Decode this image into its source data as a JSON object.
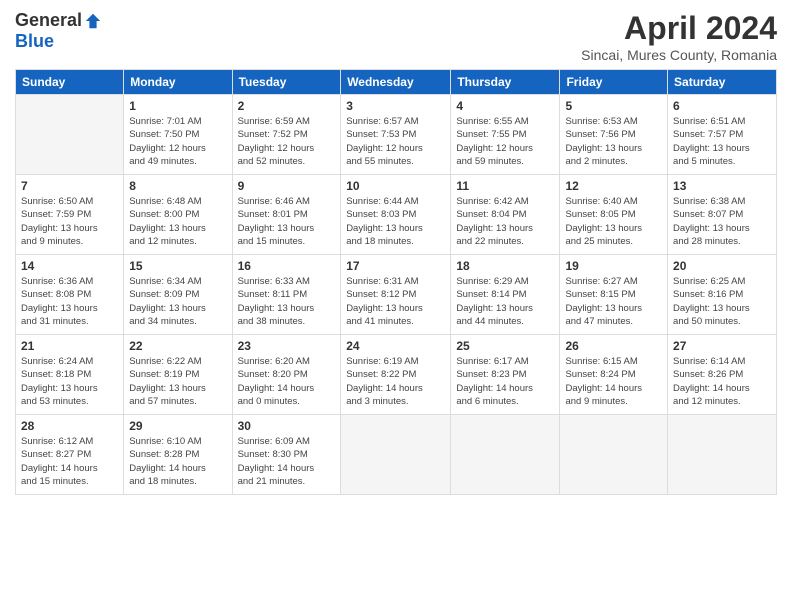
{
  "logo": {
    "general": "General",
    "blue": "Blue"
  },
  "title": "April 2024",
  "subtitle": "Sincai, Mures County, Romania",
  "days_of_week": [
    "Sunday",
    "Monday",
    "Tuesday",
    "Wednesday",
    "Thursday",
    "Friday",
    "Saturday"
  ],
  "weeks": [
    [
      {
        "num": "",
        "info": ""
      },
      {
        "num": "1",
        "info": "Sunrise: 7:01 AM\nSunset: 7:50 PM\nDaylight: 12 hours\nand 49 minutes."
      },
      {
        "num": "2",
        "info": "Sunrise: 6:59 AM\nSunset: 7:52 PM\nDaylight: 12 hours\nand 52 minutes."
      },
      {
        "num": "3",
        "info": "Sunrise: 6:57 AM\nSunset: 7:53 PM\nDaylight: 12 hours\nand 55 minutes."
      },
      {
        "num": "4",
        "info": "Sunrise: 6:55 AM\nSunset: 7:55 PM\nDaylight: 12 hours\nand 59 minutes."
      },
      {
        "num": "5",
        "info": "Sunrise: 6:53 AM\nSunset: 7:56 PM\nDaylight: 13 hours\nand 2 minutes."
      },
      {
        "num": "6",
        "info": "Sunrise: 6:51 AM\nSunset: 7:57 PM\nDaylight: 13 hours\nand 5 minutes."
      }
    ],
    [
      {
        "num": "7",
        "info": "Sunrise: 6:50 AM\nSunset: 7:59 PM\nDaylight: 13 hours\nand 9 minutes."
      },
      {
        "num": "8",
        "info": "Sunrise: 6:48 AM\nSunset: 8:00 PM\nDaylight: 13 hours\nand 12 minutes."
      },
      {
        "num": "9",
        "info": "Sunrise: 6:46 AM\nSunset: 8:01 PM\nDaylight: 13 hours\nand 15 minutes."
      },
      {
        "num": "10",
        "info": "Sunrise: 6:44 AM\nSunset: 8:03 PM\nDaylight: 13 hours\nand 18 minutes."
      },
      {
        "num": "11",
        "info": "Sunrise: 6:42 AM\nSunset: 8:04 PM\nDaylight: 13 hours\nand 22 minutes."
      },
      {
        "num": "12",
        "info": "Sunrise: 6:40 AM\nSunset: 8:05 PM\nDaylight: 13 hours\nand 25 minutes."
      },
      {
        "num": "13",
        "info": "Sunrise: 6:38 AM\nSunset: 8:07 PM\nDaylight: 13 hours\nand 28 minutes."
      }
    ],
    [
      {
        "num": "14",
        "info": "Sunrise: 6:36 AM\nSunset: 8:08 PM\nDaylight: 13 hours\nand 31 minutes."
      },
      {
        "num": "15",
        "info": "Sunrise: 6:34 AM\nSunset: 8:09 PM\nDaylight: 13 hours\nand 34 minutes."
      },
      {
        "num": "16",
        "info": "Sunrise: 6:33 AM\nSunset: 8:11 PM\nDaylight: 13 hours\nand 38 minutes."
      },
      {
        "num": "17",
        "info": "Sunrise: 6:31 AM\nSunset: 8:12 PM\nDaylight: 13 hours\nand 41 minutes."
      },
      {
        "num": "18",
        "info": "Sunrise: 6:29 AM\nSunset: 8:14 PM\nDaylight: 13 hours\nand 44 minutes."
      },
      {
        "num": "19",
        "info": "Sunrise: 6:27 AM\nSunset: 8:15 PM\nDaylight: 13 hours\nand 47 minutes."
      },
      {
        "num": "20",
        "info": "Sunrise: 6:25 AM\nSunset: 8:16 PM\nDaylight: 13 hours\nand 50 minutes."
      }
    ],
    [
      {
        "num": "21",
        "info": "Sunrise: 6:24 AM\nSunset: 8:18 PM\nDaylight: 13 hours\nand 53 minutes."
      },
      {
        "num": "22",
        "info": "Sunrise: 6:22 AM\nSunset: 8:19 PM\nDaylight: 13 hours\nand 57 minutes."
      },
      {
        "num": "23",
        "info": "Sunrise: 6:20 AM\nSunset: 8:20 PM\nDaylight: 14 hours\nand 0 minutes."
      },
      {
        "num": "24",
        "info": "Sunrise: 6:19 AM\nSunset: 8:22 PM\nDaylight: 14 hours\nand 3 minutes."
      },
      {
        "num": "25",
        "info": "Sunrise: 6:17 AM\nSunset: 8:23 PM\nDaylight: 14 hours\nand 6 minutes."
      },
      {
        "num": "26",
        "info": "Sunrise: 6:15 AM\nSunset: 8:24 PM\nDaylight: 14 hours\nand 9 minutes."
      },
      {
        "num": "27",
        "info": "Sunrise: 6:14 AM\nSunset: 8:26 PM\nDaylight: 14 hours\nand 12 minutes."
      }
    ],
    [
      {
        "num": "28",
        "info": "Sunrise: 6:12 AM\nSunset: 8:27 PM\nDaylight: 14 hours\nand 15 minutes."
      },
      {
        "num": "29",
        "info": "Sunrise: 6:10 AM\nSunset: 8:28 PM\nDaylight: 14 hours\nand 18 minutes."
      },
      {
        "num": "30",
        "info": "Sunrise: 6:09 AM\nSunset: 8:30 PM\nDaylight: 14 hours\nand 21 minutes."
      },
      {
        "num": "",
        "info": ""
      },
      {
        "num": "",
        "info": ""
      },
      {
        "num": "",
        "info": ""
      },
      {
        "num": "",
        "info": ""
      }
    ]
  ]
}
